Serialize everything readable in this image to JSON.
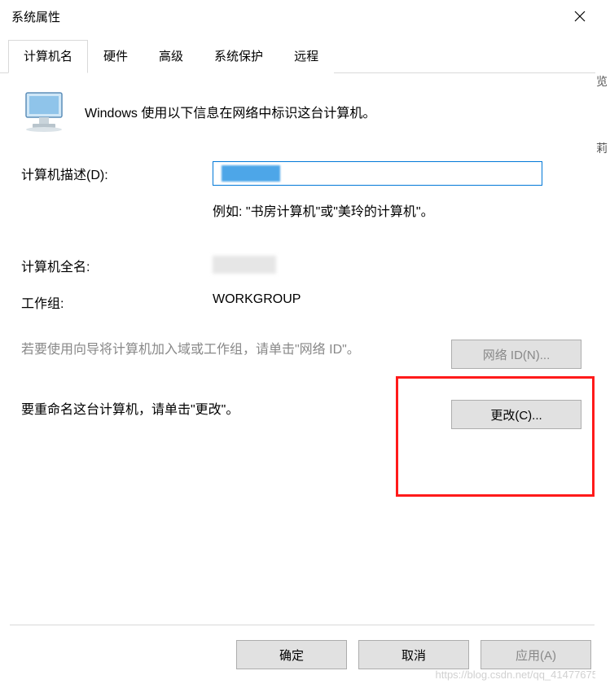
{
  "window": {
    "title": "系统属性"
  },
  "tabs": [
    {
      "label": "计算机名",
      "active": true
    },
    {
      "label": "硬件",
      "active": false
    },
    {
      "label": "高级",
      "active": false
    },
    {
      "label": "系统保护",
      "active": false
    },
    {
      "label": "远程",
      "active": false
    }
  ],
  "intro": "Windows 使用以下信息在网络中标识这台计算机。",
  "description": {
    "label": "计算机描述(D):",
    "value": "",
    "example": "例如: \"书房计算机\"或\"美玲的计算机\"。"
  },
  "fullname": {
    "label": "计算机全名:",
    "value": ""
  },
  "workgroup": {
    "label": "工作组:",
    "value": "WORKGROUP"
  },
  "network_id": {
    "text": "若要使用向导将计算机加入域或工作组，请单击\"网络 ID\"。",
    "button": "网络 ID(N)..."
  },
  "change": {
    "text": "要重命名这台计算机，请单击\"更改\"。",
    "button": "更改(C)..."
  },
  "footer": {
    "ok": "确定",
    "cancel": "取消",
    "apply": "应用(A)"
  },
  "watermark": "https://blog.csdn.net/qq_41477675"
}
